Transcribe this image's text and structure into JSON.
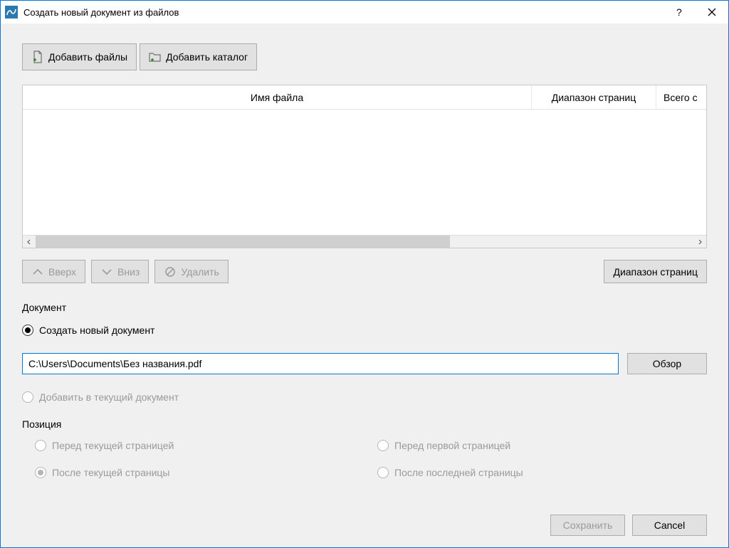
{
  "window": {
    "title": "Создать новый документ из файлов"
  },
  "toolbar": {
    "add_files": "Добавить файлы",
    "add_folder": "Добавить каталог"
  },
  "grid": {
    "columns": {
      "filename": "Имя файла",
      "page_range": "Диапазон страниц",
      "total": "Всего с"
    }
  },
  "actions": {
    "up": "Вверх",
    "down": "Вниз",
    "delete": "Удалить",
    "page_range": "Диапазон страниц"
  },
  "document": {
    "section_label": "Документ",
    "create_new": "Создать новый документ",
    "path": "C:\\Users\\Documents\\Без названия.pdf",
    "browse": "Обзор",
    "add_to_current": "Добавить в текущий документ",
    "position_label": "Позиция",
    "pos_before_current": "Перед текущей страницей",
    "pos_after_current": "После текущей страницы",
    "pos_before_first": "Перед первой страницей",
    "pos_after_last": "После последней страницы"
  },
  "footer": {
    "save": "Сохранить",
    "cancel": "Cancel"
  }
}
